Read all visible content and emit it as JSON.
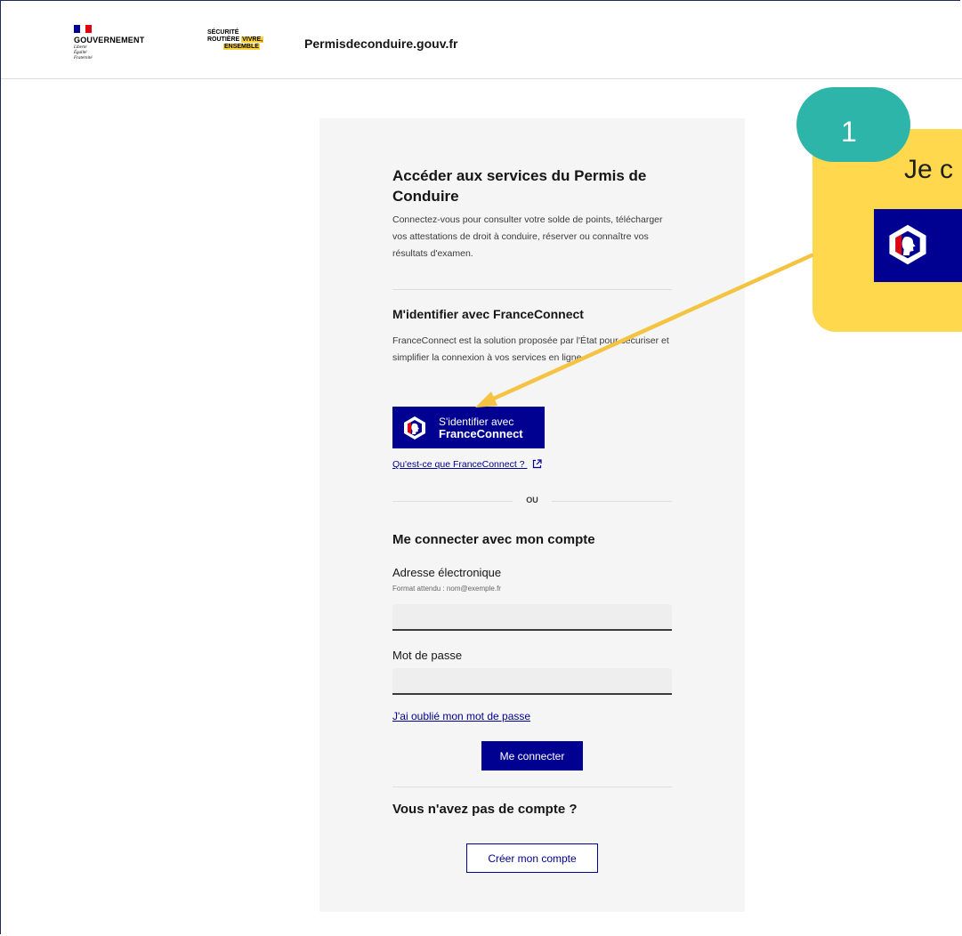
{
  "header": {
    "gov_name": "GOUVERNEMENT",
    "motto": [
      "Liberté",
      "Égalité",
      "Fraternité"
    ],
    "securite_routiere": {
      "line1": "SÉCURITÉ",
      "line2": "ROUTIÈRE",
      "highlight1": "VIVRE,",
      "highlight2": "ENSEMBLE"
    },
    "site_name": "Permisdeconduire.gouv.fr"
  },
  "main": {
    "title": "Accéder aux services du Permis de Conduire",
    "intro": "Connectez-vous pour consulter votre solde de points, télécharger vos attestations de droit à conduire, réserver ou connaître vos résultats d'examen.",
    "franceconnect": {
      "title": "M'identifier avec FranceConnect",
      "description": "FranceConnect est la solution proposée par l'État pour sécuriser et simplifier la connexion à vos services en ligne",
      "button_line1": "S'identifier avec",
      "button_line2": "FranceConnect",
      "help_link": "Qu'est-ce que FranceConnect ?"
    },
    "separator": "OU",
    "account": {
      "title": "Me connecter avec mon compte",
      "email_label": "Adresse électronique",
      "email_hint": "Format attendu : nom@exemple.fr",
      "email_value": "",
      "password_label": "Mot de passe",
      "password_value": "",
      "forgot_link": "J'ai oublié mon mot de passe",
      "submit": "Me connecter"
    },
    "signup": {
      "title": "Vous n'avez pas de compte ?",
      "button": "Créer mon compte"
    }
  },
  "callout": {
    "step": "1",
    "text": "Je c"
  },
  "colors": {
    "dsfr_blue": "#000091",
    "marianne_red": "#e1000f",
    "callout_yellow": "#ffd84d",
    "badge_teal": "#2cb5a8",
    "arrow": "#f5c342"
  }
}
